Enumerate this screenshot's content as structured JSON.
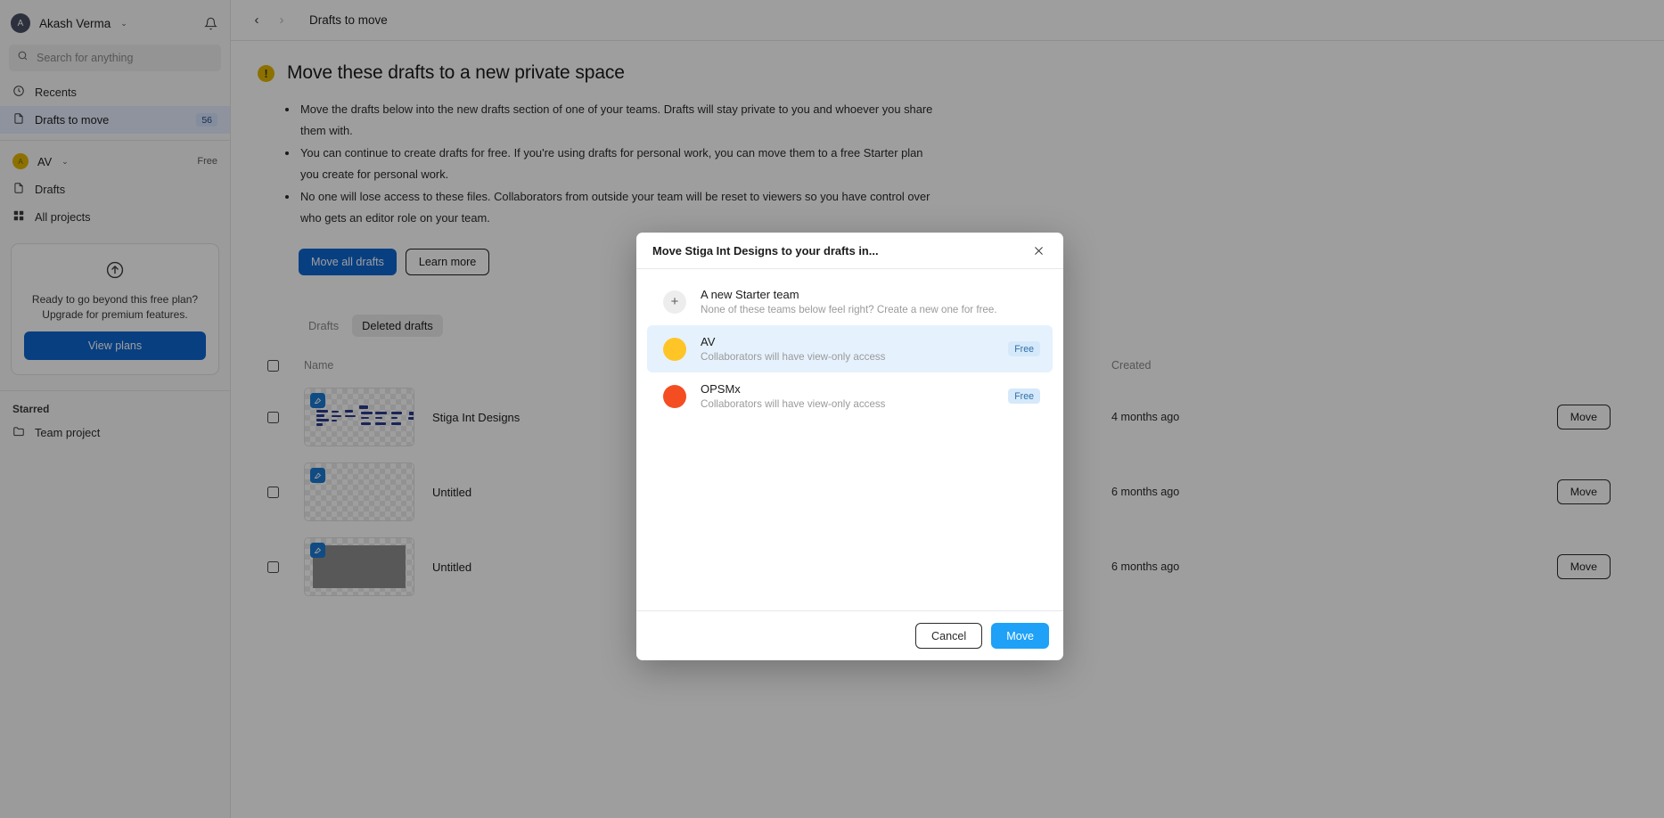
{
  "sidebar": {
    "account": {
      "name": "Akash Verma",
      "avatar_initial": "A",
      "chevron": "⌄",
      "notifications_icon": "bell-icon"
    },
    "search": {
      "placeholder": "Search for anything",
      "icon": "search-icon"
    },
    "nav": [
      {
        "label": "Recents",
        "icon": "clock-icon",
        "badge": "",
        "active": false
      },
      {
        "label": "Drafts to move",
        "icon": "file-icon",
        "badge": "56",
        "active": true
      }
    ],
    "team": {
      "name": "AV",
      "avatar_initial": "A",
      "chevron": "⌄",
      "plan_badge": "Free"
    },
    "team_nav": [
      {
        "label": "Drafts",
        "icon": "file-icon"
      },
      {
        "label": "All projects",
        "icon": "grid-icon"
      }
    ],
    "upsell": {
      "icon": "arrow-up-circle-icon",
      "line1": "Ready to go beyond this free plan?",
      "line2": "Upgrade for premium features.",
      "cta": "View plans"
    },
    "starred": {
      "label": "Starred",
      "items": [
        {
          "label": "Team project",
          "icon": "folder-icon"
        }
      ]
    }
  },
  "topbar": {
    "back_icon": "chevron-left-icon",
    "forward_icon": "chevron-right-icon",
    "breadcrumb": "Drafts to move"
  },
  "banner": {
    "warning_icon": "warning-icon",
    "heading": "Move these drafts to a new private space",
    "bullets": [
      "Move the drafts below into the new drafts section of one of your teams. Drafts will stay private to you and whoever you share them with.",
      "You can continue to create drafts for free. If you're using drafts for personal work, you can move them to a free Starter plan you create for personal work.",
      "No one will lose access to these files. Collaborators from outside your team will be reset to viewers so you have control over who gets an editor role on your team."
    ],
    "primary_button": "Move all drafts",
    "secondary_button": "Learn more"
  },
  "tabs": [
    {
      "label": "Drafts",
      "active": false
    },
    {
      "label": "Deleted drafts",
      "active": true
    }
  ],
  "table": {
    "columns": {
      "name": "Name",
      "created": "Created"
    },
    "rows": [
      {
        "name": "Stiga Int Designs",
        "created": "4 months ago",
        "action": "Move",
        "thumb": "wireframe"
      },
      {
        "name": "Untitled",
        "created": "6 months ago",
        "action": "Move",
        "thumb": "empty"
      },
      {
        "name": "Untitled",
        "created": "6 months ago",
        "action": "Move",
        "thumb": "gray"
      }
    ]
  },
  "modal": {
    "title": "Move Stiga Int Designs to your drafts in...",
    "close_icon": "close-icon",
    "options": [
      {
        "title": "A new Starter team",
        "subtitle": "None of these teams below feel right? Create a new one for free.",
        "badge": "",
        "icon": "plus-icon",
        "color": "#ededed",
        "selected": false
      },
      {
        "title": "AV",
        "subtitle": "Collaborators will have view-only access",
        "badge": "Free",
        "icon": "team-avatar",
        "color": "#ffc526",
        "selected": true
      },
      {
        "title": "OPSMx",
        "subtitle": "Collaborators will have view-only access",
        "badge": "Free",
        "icon": "team-avatar",
        "color": "#f44d22",
        "selected": false
      }
    ],
    "cancel_label": "Cancel",
    "confirm_label": "Move"
  },
  "colors": {
    "accent_blue": "#0d66d0",
    "modal_confirm_blue": "#1ea1f7",
    "selected_row": "#e5f2fd",
    "badge_blue": "#d6e9fb",
    "warning_yellow": "#e3b600"
  }
}
